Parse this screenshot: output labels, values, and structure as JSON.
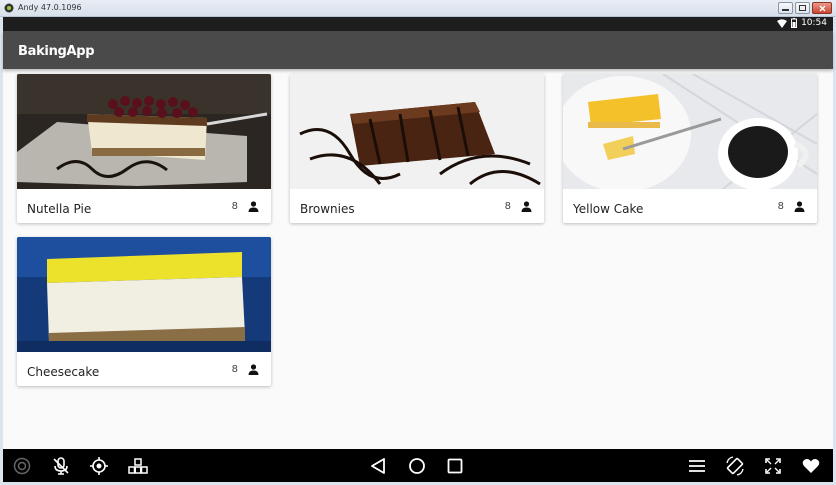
{
  "window": {
    "title": "Andy 47.0.1096"
  },
  "status_bar": {
    "time": "10:54"
  },
  "app_bar": {
    "title": "BakingApp"
  },
  "recipes": [
    {
      "name": "Nutella Pie",
      "servings": "8"
    },
    {
      "name": "Brownies",
      "servings": "8"
    },
    {
      "name": "Yellow Cake",
      "servings": "8"
    },
    {
      "name": "Cheesecake",
      "servings": "8"
    }
  ],
  "colors": {
    "app_bar": "#4a4a4a",
    "status_bar": "#1e1e1e",
    "background": "#fafafa",
    "nav_bar": "#000000"
  }
}
